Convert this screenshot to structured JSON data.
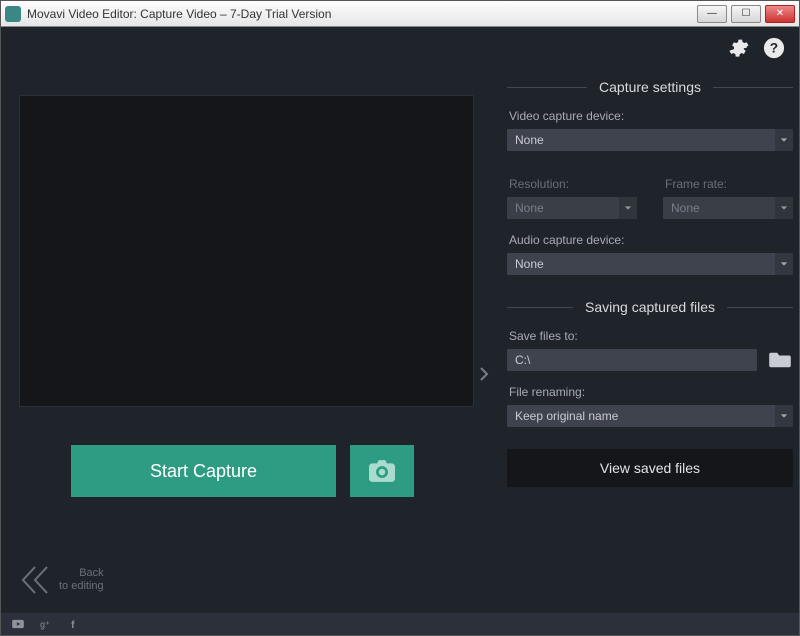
{
  "titlebar": {
    "title": "Movavi Video Editor: Capture Video – 7-Day Trial Version"
  },
  "capture": {
    "start_label": "Start Capture"
  },
  "back": {
    "line1": "Back",
    "line2": "to editing"
  },
  "settings": {
    "capture_header": "Capture settings",
    "video_device_label": "Video capture device:",
    "video_device_value": "None",
    "resolution_label": "Resolution:",
    "resolution_value": "None",
    "framerate_label": "Frame rate:",
    "framerate_value": "None",
    "audio_device_label": "Audio capture device:",
    "audio_device_value": "None",
    "saving_header": "Saving captured files",
    "save_to_label": "Save files to:",
    "save_to_value": "C:\\",
    "renaming_label": "File renaming:",
    "renaming_value": "Keep original name",
    "view_files_label": "View saved files"
  }
}
